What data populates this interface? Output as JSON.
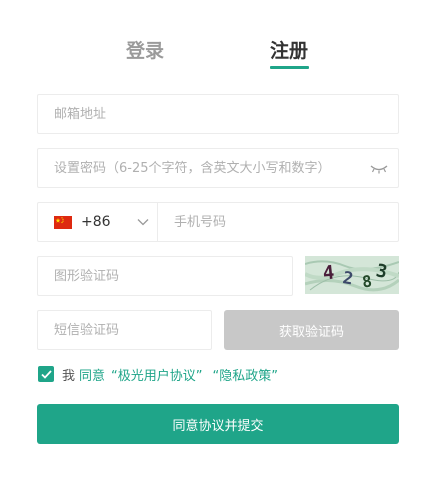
{
  "tabs": {
    "login": "登录",
    "register": "注册",
    "active": "register"
  },
  "form": {
    "email_placeholder": "邮箱地址",
    "password_placeholder": "设置密码（6-25个字符，含英文大小写和数字）",
    "country_code": "+86",
    "phone_placeholder": "手机号码",
    "captcha_placeholder": "图形验证码",
    "captcha_text": "4283",
    "sms_placeholder": "短信验证码",
    "sms_button": "获取验证码"
  },
  "agreement": {
    "checked": true,
    "prefix": "我",
    "agree": "同意",
    "user_agreement": "“极光用户协议”",
    "privacy_policy": "“隐私政策”"
  },
  "submit_label": "同意协议并提交",
  "colors": {
    "accent": "#1fa589",
    "disabled_button": "#c8c8c8",
    "border": "#ececec"
  },
  "icons": {
    "password_toggle": "eye-closed-icon",
    "country_flag": "china-flag-icon",
    "dropdown": "chevron-down-icon",
    "checkbox": "check-icon"
  }
}
